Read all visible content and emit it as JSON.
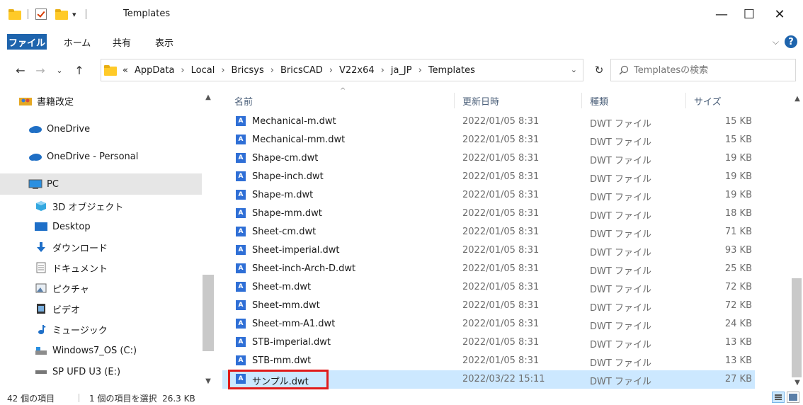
{
  "window": {
    "title": "Templates",
    "minimize": "—",
    "maximize": "☐",
    "close": "✕"
  },
  "ribbon": {
    "tabs": [
      "ファイル",
      "ホーム",
      "共有",
      "表示"
    ],
    "help": "?"
  },
  "address": {
    "breadcrumbs": [
      "«",
      "AppData",
      "Local",
      "Bricsys",
      "BricsCAD",
      "V22x64",
      "ja_JP",
      "Templates"
    ],
    "separator": "›"
  },
  "search": {
    "placeholder": "Templatesの検索"
  },
  "nav_pane": {
    "items": [
      {
        "label": "書籍改定",
        "icon": "people-folder-icon"
      },
      {
        "label": "OneDrive",
        "icon": "cloud-icon"
      },
      {
        "label": "OneDrive - Personal",
        "icon": "cloud-icon"
      },
      {
        "label": "PC",
        "icon": "pc-icon"
      },
      {
        "label": "3D オブジェクト",
        "icon": "cube-icon"
      },
      {
        "label": "Desktop",
        "icon": "desktop-icon"
      },
      {
        "label": "ダウンロード",
        "icon": "download-icon"
      },
      {
        "label": "ドキュメント",
        "icon": "document-icon"
      },
      {
        "label": "ピクチャ",
        "icon": "picture-icon"
      },
      {
        "label": "ビデオ",
        "icon": "video-icon"
      },
      {
        "label": "ミュージック",
        "icon": "music-icon"
      },
      {
        "label": "Windows7_OS (C:)",
        "icon": "drive-icon"
      },
      {
        "label": "SP UFD U3 (E:)",
        "icon": "usb-drive-icon"
      }
    ]
  },
  "columns": {
    "name": "名前",
    "date": "更新日時",
    "type": "種類",
    "size": "サイズ"
  },
  "files": [
    {
      "name": "Mechanical-m.dwt",
      "date": "2022/01/05 8:31",
      "type": "DWT ファイル",
      "size": "15 KB"
    },
    {
      "name": "Mechanical-mm.dwt",
      "date": "2022/01/05 8:31",
      "type": "DWT ファイル",
      "size": "15 KB"
    },
    {
      "name": "Shape-cm.dwt",
      "date": "2022/01/05 8:31",
      "type": "DWT ファイル",
      "size": "19 KB"
    },
    {
      "name": "Shape-inch.dwt",
      "date": "2022/01/05 8:31",
      "type": "DWT ファイル",
      "size": "19 KB"
    },
    {
      "name": "Shape-m.dwt",
      "date": "2022/01/05 8:31",
      "type": "DWT ファイル",
      "size": "19 KB"
    },
    {
      "name": "Shape-mm.dwt",
      "date": "2022/01/05 8:31",
      "type": "DWT ファイル",
      "size": "18 KB"
    },
    {
      "name": "Sheet-cm.dwt",
      "date": "2022/01/05 8:31",
      "type": "DWT ファイル",
      "size": "71 KB"
    },
    {
      "name": "Sheet-imperial.dwt",
      "date": "2022/01/05 8:31",
      "type": "DWT ファイル",
      "size": "93 KB"
    },
    {
      "name": "Sheet-inch-Arch-D.dwt",
      "date": "2022/01/05 8:31",
      "type": "DWT ファイル",
      "size": "25 KB"
    },
    {
      "name": "Sheet-m.dwt",
      "date": "2022/01/05 8:31",
      "type": "DWT ファイル",
      "size": "72 KB"
    },
    {
      "name": "Sheet-mm.dwt",
      "date": "2022/01/05 8:31",
      "type": "DWT ファイル",
      "size": "72 KB"
    },
    {
      "name": "Sheet-mm-A1.dwt",
      "date": "2022/01/05 8:31",
      "type": "DWT ファイル",
      "size": "24 KB"
    },
    {
      "name": "STB-imperial.dwt",
      "date": "2022/01/05 8:31",
      "type": "DWT ファイル",
      "size": "13 KB"
    },
    {
      "name": "STB-mm.dwt",
      "date": "2022/01/05 8:31",
      "type": "DWT ファイル",
      "size": "13 KB"
    },
    {
      "name": "サンプル.dwt",
      "date": "2022/03/22 15:11",
      "type": "DWT ファイル",
      "size": "27 KB",
      "selected": true
    }
  ],
  "status": {
    "count": "42 個の項目",
    "selection": "1 個の項目を選択  26.3 KB"
  },
  "colors": {
    "accent": "#1e64ad",
    "selection": "#cce8ff",
    "highlight_box": "#e01b1b"
  }
}
